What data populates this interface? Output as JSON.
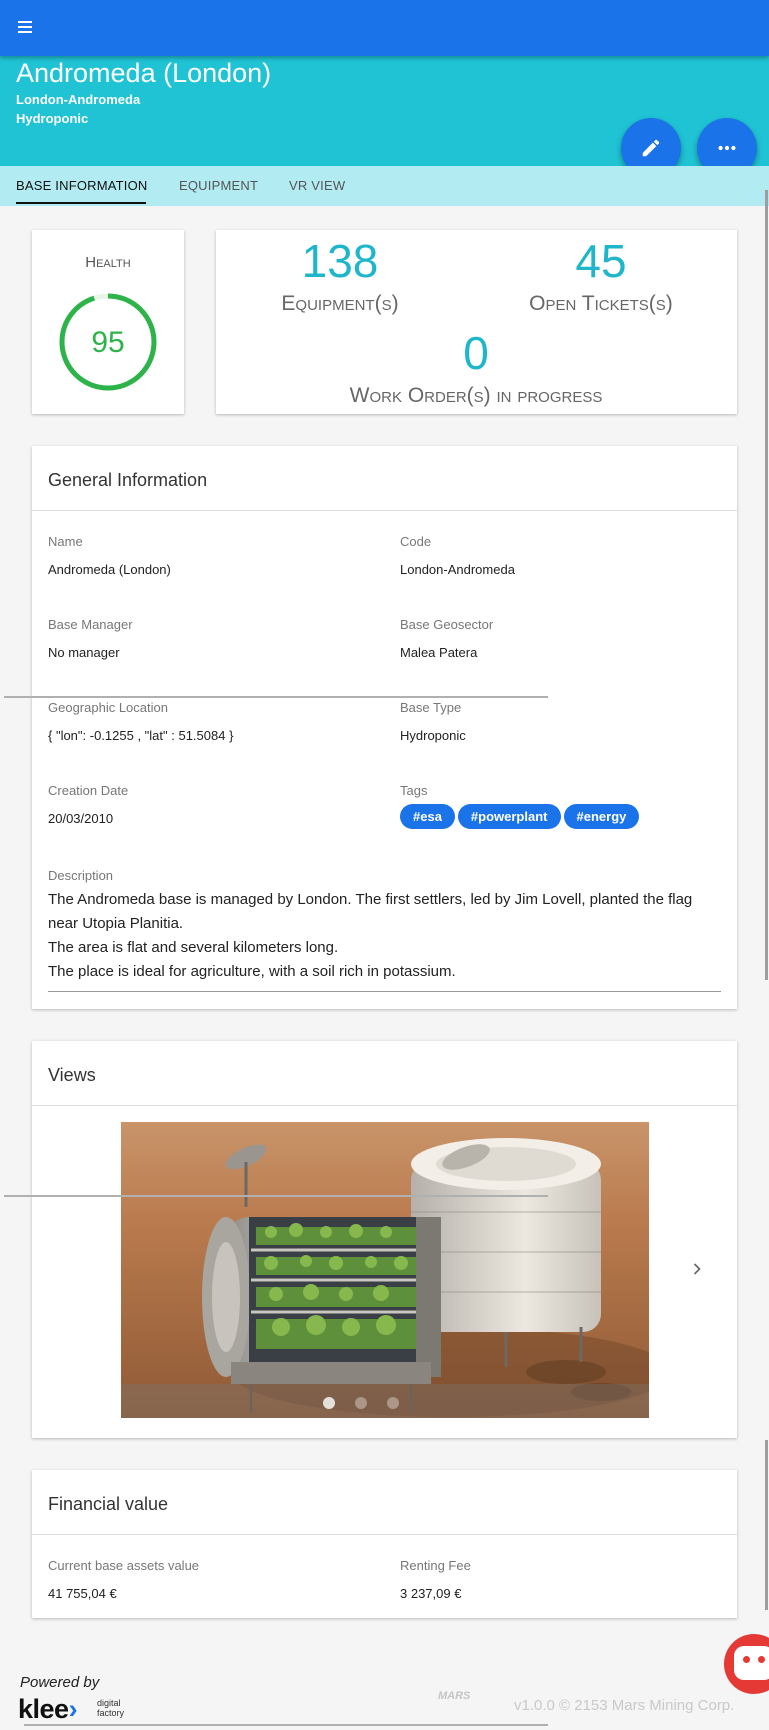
{
  "header": {
    "title": "Andromeda (London)",
    "code": "London-Andromeda",
    "type": "Hydroponic"
  },
  "tabs": [
    {
      "label": "BASE INFORMATION",
      "active": true
    },
    {
      "label": "EQUIPMENT",
      "active": false
    },
    {
      "label": "VR VIEW",
      "active": false
    }
  ],
  "health": {
    "label": "Health",
    "value": "95",
    "percent": 95,
    "color": "#2eb34a"
  },
  "stats": {
    "equipment": {
      "value": "138",
      "label": "Equipment(s)"
    },
    "tickets": {
      "value": "45",
      "label": "Open Tickets(s)"
    },
    "work_orders": {
      "value": "0",
      "label": "Work Order(s) in progress"
    }
  },
  "general": {
    "title": "General Information",
    "name_label": "Name",
    "name_value": "Andromeda (London)",
    "code_label": "Code",
    "code_value": "London-Andromeda",
    "manager_label": "Base Manager",
    "manager_value": "No manager",
    "geosector_label": "Base Geosector",
    "geosector_value": "Malea Patera",
    "location_label": "Geographic Location",
    "location_value": "{ \"lon\": -0.1255 , \"lat\" : 51.5084 }",
    "basetype_label": "Base Type",
    "basetype_value": "Hydroponic",
    "date_label": "Creation Date",
    "date_value": "20/03/2010",
    "tags_label": "Tags",
    "tags": [
      "#esa",
      "#powerplant",
      "#energy"
    ],
    "description_label": "Description",
    "description_lines": [
      "The Andromeda base is managed by London. The first settlers, led by Jim Lovell, planted the flag near Utopia Planitia.",
      "The area is flat and several kilometers long.",
      "The place is ideal for agriculture, with a soil rich in potassium."
    ]
  },
  "views": {
    "title": "Views",
    "slides": 3,
    "active_slide": 1
  },
  "financial": {
    "title": "Financial value",
    "assets_label": "Current base assets value",
    "assets_value": "41 755,04 €",
    "fee_label": "Renting Fee",
    "fee_value": "3 237,09 €"
  },
  "footer": {
    "powered_by": "Powered by",
    "brand": "klee",
    "brand_sub_1": "digital",
    "brand_sub_2": "factory",
    "partner_logo": "MARS",
    "version": "v1.0.0 © 2153 Mars Mining Corp."
  },
  "colors": {
    "primary": "#1a73e8",
    "header": "#1fc3d3",
    "tabs_bg": "#b2ebf2",
    "stat": "#1fb6cc"
  }
}
